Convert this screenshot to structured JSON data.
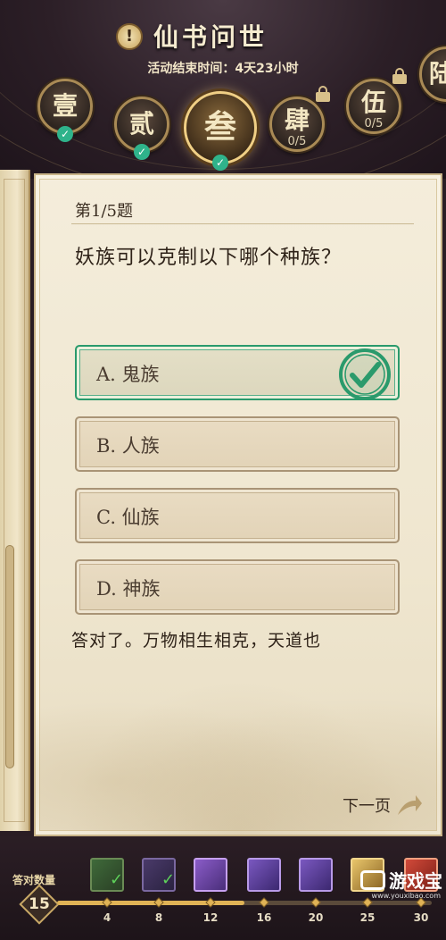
{
  "header": {
    "title": "仙书问世",
    "end_time": "活动结束时间：4天23小时",
    "info_icon": "!",
    "chapters": [
      {
        "glyph": "壹",
        "state": "done"
      },
      {
        "glyph": "贰",
        "state": "done"
      },
      {
        "glyph": "叁",
        "state": "active"
      },
      {
        "glyph": "肆",
        "state": "locked",
        "progress": "0/5"
      },
      {
        "glyph": "伍",
        "state": "locked",
        "progress": "0/5"
      },
      {
        "glyph": "陆",
        "state": "locked"
      }
    ]
  },
  "question": {
    "number": "第1/5题",
    "text": "妖族可以克制以下哪个种族？",
    "options": [
      {
        "label": "A. 鬼族",
        "correct": true
      },
      {
        "label": "B. 人族",
        "correct": false
      },
      {
        "label": "C. 仙族",
        "correct": false
      },
      {
        "label": "D. 神族",
        "correct": false
      }
    ],
    "feedback": "答对了。万物相生相克，天道也",
    "next_page": "下一页"
  },
  "progress": {
    "answered_label": "答对数量",
    "answered_count": "15",
    "fill_fraction": 0.5,
    "milestones": [
      {
        "value": "4",
        "reward": "green-scroll",
        "claimed": true
      },
      {
        "value": "8",
        "reward": "purple-scroll",
        "claimed": true
      },
      {
        "value": "12",
        "reward": "purple-gift",
        "claimed": false
      },
      {
        "value": "16",
        "reward": "purple-figure",
        "claimed": false
      },
      {
        "value": "20",
        "reward": "purple-figure",
        "claimed": false
      },
      {
        "value": "25",
        "reward": "gold-chest",
        "claimed": false
      },
      {
        "value": "30",
        "reward": "red-book",
        "claimed": false
      }
    ]
  },
  "watermark": {
    "text": "游戏宝",
    "sub": "www.youxibao.com"
  },
  "colors": {
    "correct": "#2a9a6c",
    "gold": "#e0b356",
    "card": "#f4eddb"
  }
}
